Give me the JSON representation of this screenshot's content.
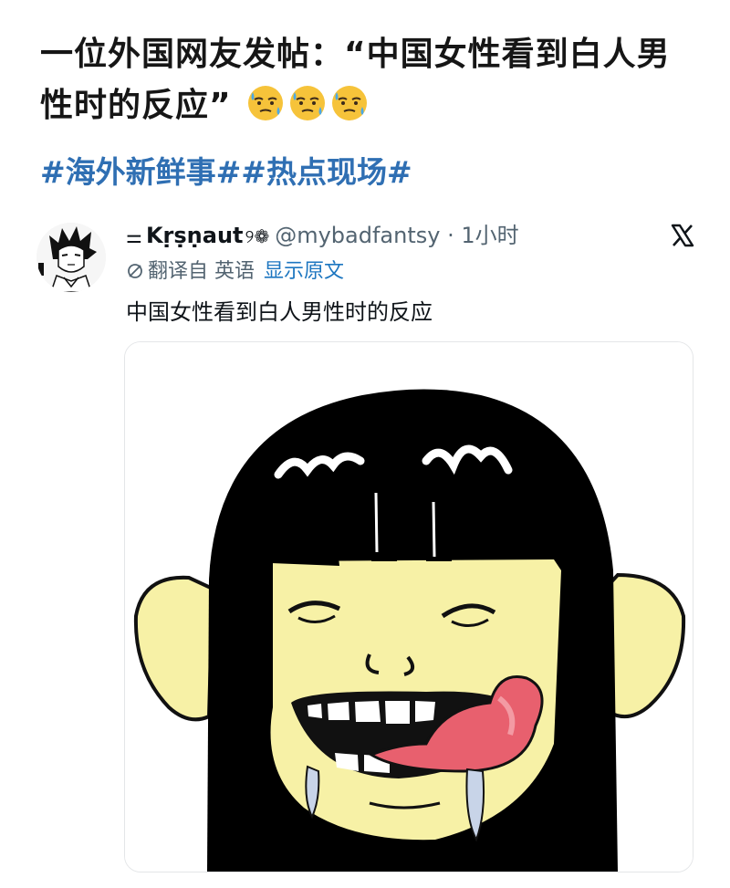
{
  "post": {
    "title": "一位外国网友发帖：“中国女性看到白人男性时的反应”",
    "emoji_icons": [
      "cold-sweat-face-icon",
      "cold-sweat-face-icon",
      "cold-sweat-face-icon"
    ],
    "hashtags": "#海外新鲜事##热点现场#"
  },
  "tweet": {
    "name_prefix": "⚌",
    "display_name": "Kṛṣṇaut",
    "name_suffix": "୨❁",
    "handle": "@mybadfantsy",
    "time": "· 1小时",
    "translated_from": "翻译自 英语",
    "show_original": "显示原文",
    "text": "中国女性看到白人男性时的反应",
    "platform_icon": "x-logo-icon",
    "avatar_icon": "anime-boy-avatar-icon"
  },
  "colors": {
    "hashtag": "#2f6fb3",
    "link": "#1d76c0",
    "muted": "#536471",
    "skin": "#f7f1a6",
    "tongue": "#e8606e"
  }
}
